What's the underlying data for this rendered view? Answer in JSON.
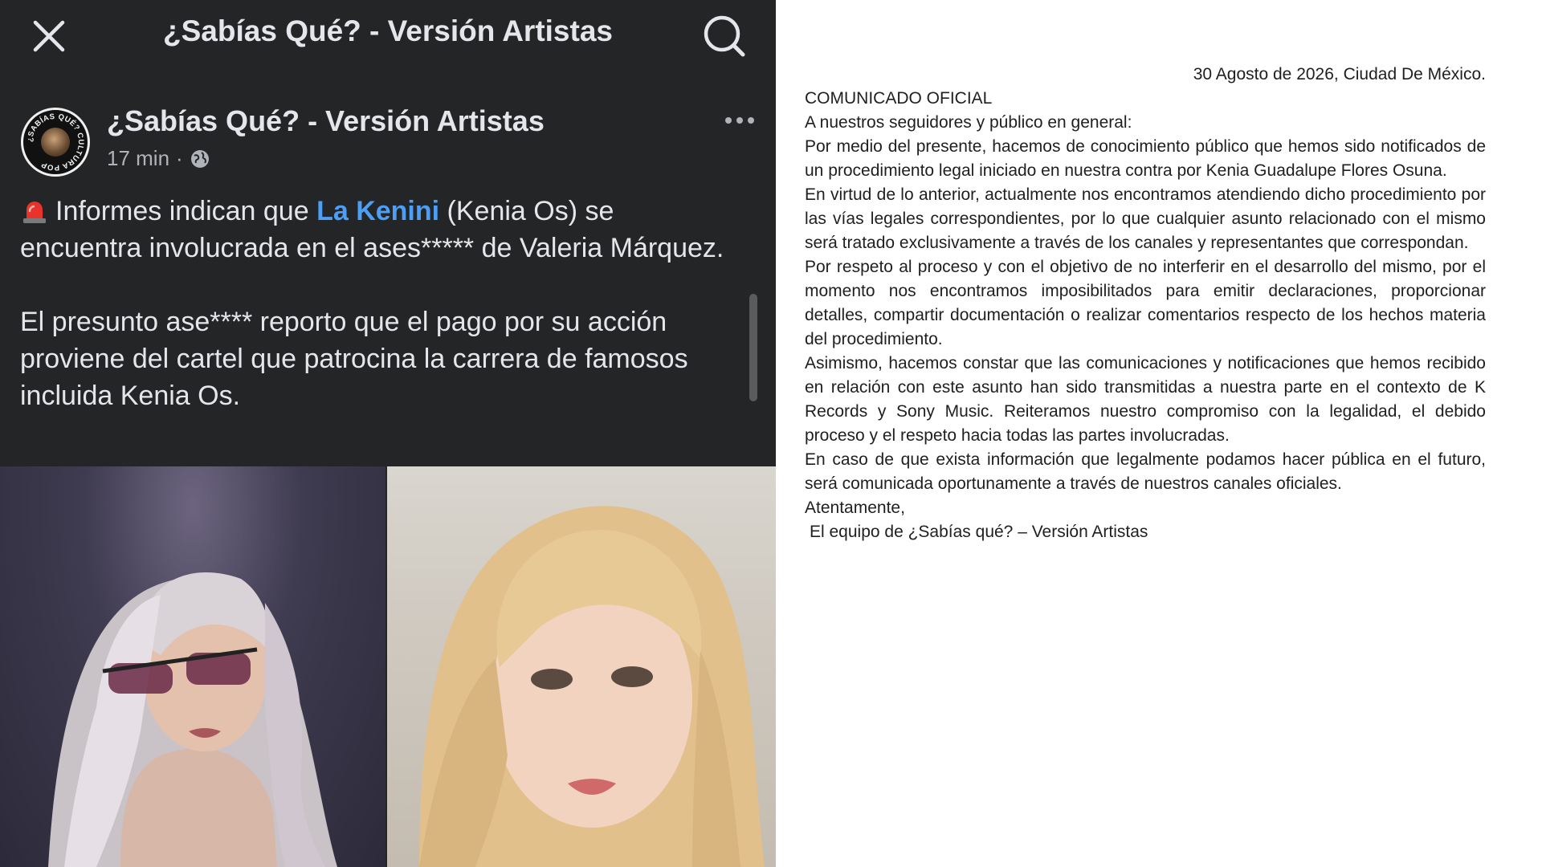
{
  "post": {
    "topbar_title": "¿Sabías Qué? - Versión Artistas",
    "page_name": "¿Sabías Qué? - Versión Artistas",
    "avatar_ring_text": "¿SABÍAS QUÉ? CULTURA POP",
    "time": "17 min",
    "dot": "·",
    "para1_before": "Informes indican que ",
    "mention": "La Kenini",
    "para1_after": " (Kenia Os) se encuentra involucrada en el ases***** de Valeria Márquez.",
    "para2": "El presunto ase**** reporto que el pago por su acción proviene del cartel que patrocina la carrera de famosos incluida Kenia Os.",
    "icons": {
      "close": "close-icon",
      "search": "search-icon",
      "more": "more-icon",
      "globe": "globe-icon",
      "siren": "siren-icon"
    }
  },
  "statement": {
    "date": "30 Agosto de 2026, Ciudad De México.",
    "heading": "COMUNICADO OFICIAL",
    "greeting": "A nuestros seguidores y público en general:",
    "paragraphs": [
      "Por medio del presente, hacemos de conocimiento público que hemos sido notificados de un procedimiento legal iniciado en nuestra contra por Kenia Guadalupe Flores Osuna.",
      "En virtud de lo anterior, actualmente nos encontramos atendiendo dicho procedimiento por las vías legales correspondientes, por lo que cualquier asunto relacionado con el mismo será tratado exclusivamente a través de los canales y representantes que correspondan.",
      "Por respeto al proceso y con el objetivo de no interferir en el desarrollo del mismo, por el momento nos encontramos imposibilitados para emitir declaraciones, proporcionar detalles, compartir documentación o realizar comentarios respecto de los hechos materia del procedimiento.",
      "Asimismo, hacemos constar que las comunicaciones y notificaciones que hemos recibido en relación con este asunto han sido transmitidas a nuestra parte en el contexto de K Records y Sony Music. Reiteramos nuestro compromiso con la legalidad, el debido proceso y el respeto hacia todas las partes involucradas.",
      "En caso de que exista información que legalmente podamos hacer pública en el futuro, será comunicada oportunamente a través de nuestros canales oficiales."
    ],
    "closing": "Atentamente,",
    "signature": "El equipo de ¿Sabías qué? – Versión Artistas"
  },
  "colors": {
    "panel_bg": "#242526",
    "text_primary": "#e4e6eb",
    "text_secondary": "#b0b3b8",
    "mention": "#4d9ff5",
    "doc_text": "#1f1f1f"
  }
}
